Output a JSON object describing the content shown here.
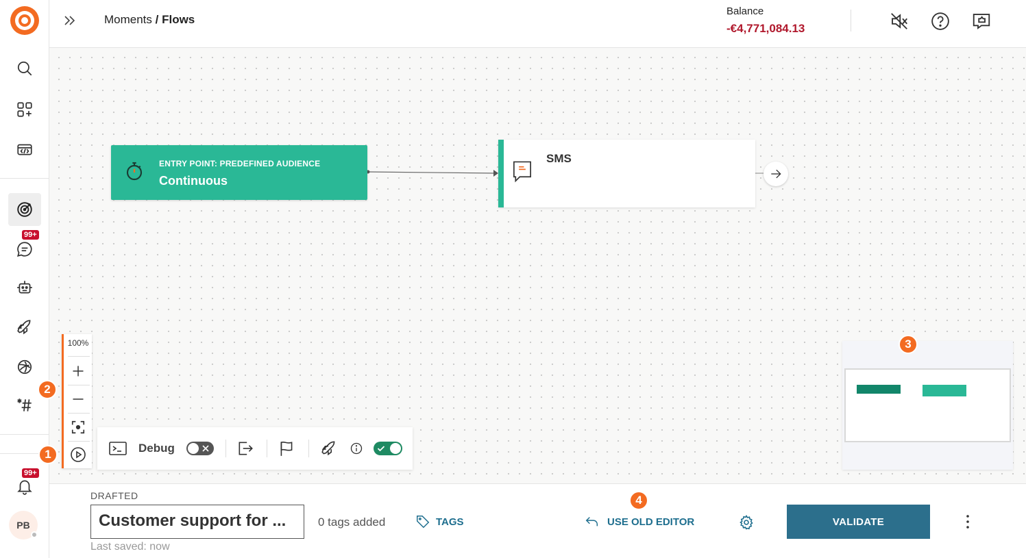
{
  "sidebar": {
    "messages_badge": "99+",
    "notifications_badge": "99+",
    "avatar_initials": "PB"
  },
  "header": {
    "breadcrumb_parent": "Moments",
    "breadcrumb_separator": " / ",
    "breadcrumb_current": "Flows",
    "balance_label": "Balance",
    "balance_value": "-€4,771,084.13"
  },
  "canvas": {
    "entry_node": {
      "label": "ENTRY POINT: PREDEFINED AUDIENCE",
      "title": "Continuous"
    },
    "sms_node": {
      "title": "SMS"
    },
    "zoom_level": "100%",
    "debug_toolbar": {
      "debug_label": "Debug",
      "debug_enabled": false,
      "validation_enabled": true
    },
    "markers": [
      "1",
      "2",
      "3",
      "4"
    ]
  },
  "footer": {
    "status": "DRAFTED",
    "flow_name": "Customer support for ...",
    "last_saved": "Last saved: now",
    "tags_count": "0 tags added",
    "tags_button": "TAGS",
    "old_editor_button": "USE OLD EDITOR",
    "validate_button": "VALIDATE"
  },
  "colors": {
    "brand_orange": "#f36b21",
    "node_green": "#2ab896",
    "balance_red": "#b0182c",
    "primary_blue": "#2c6f8c"
  }
}
